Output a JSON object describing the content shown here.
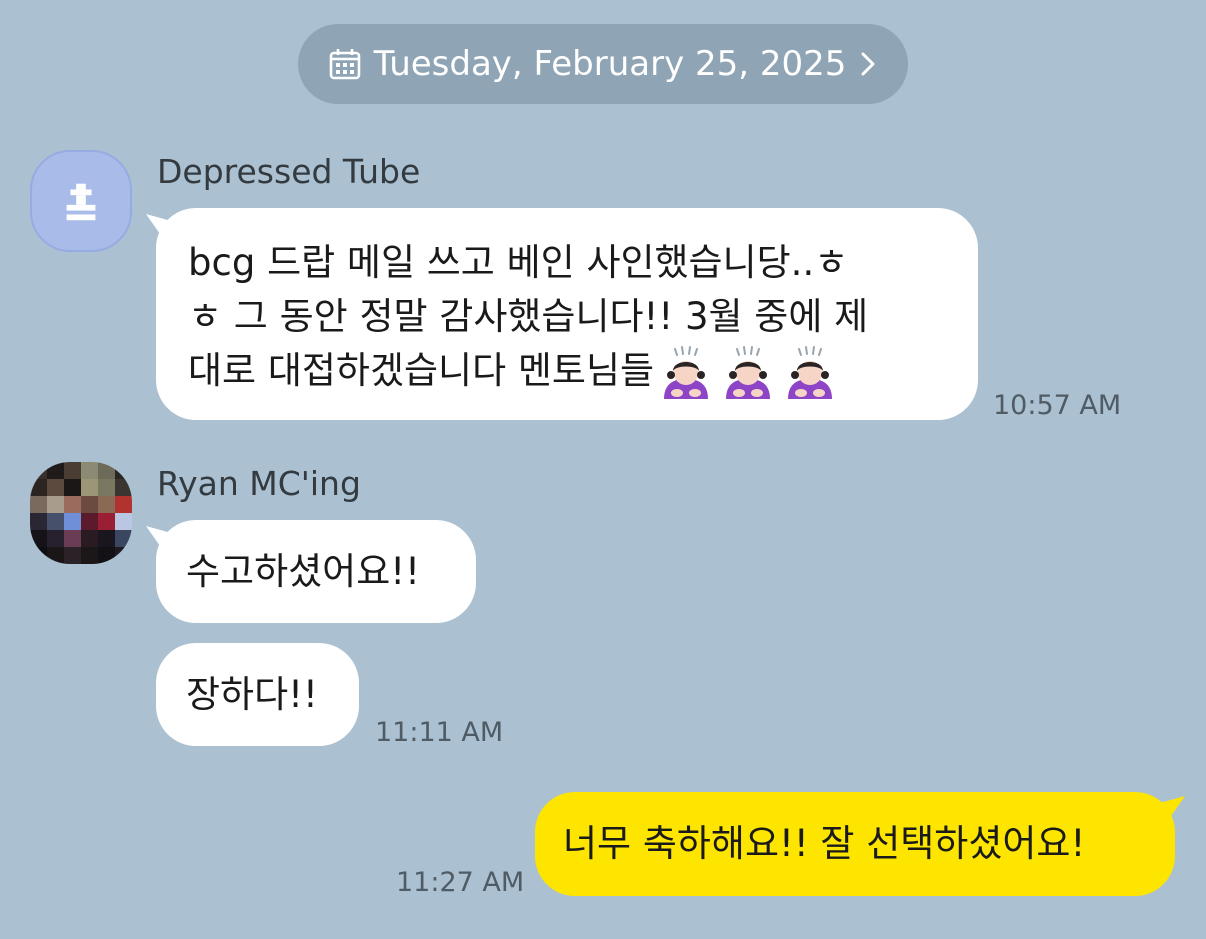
{
  "date_divider": {
    "label": "Tuesday, February 25, 2025",
    "icon": "calendar-icon",
    "chevron_icon": "chevron-right-icon"
  },
  "messages": [
    {
      "sender": "Depressed Tube",
      "avatar": "default-profile-icon",
      "bubbles": [
        {
          "lines": [
            "bcg 드랍 메일 쓰고 베인 사인했습니당..ㅎ",
            "ㅎ 그 동안 정말 감사했습니다!! 3월 중에 제",
            "대로 대접하겠습니다 멘토님들"
          ],
          "emojis": [
            "person-bowing-emoji",
            "person-bowing-emoji",
            "person-bowing-emoji"
          ]
        }
      ],
      "time": "10:57 AM"
    },
    {
      "sender": "Ryan MC'ing",
      "avatar": "pixelated-photo-avatar",
      "bubbles": [
        {
          "text": "수고하셨어요!!"
        },
        {
          "text": "장하다!!"
        }
      ],
      "time": "11:11 AM"
    },
    {
      "sender": "",
      "mine": true,
      "bubbles": [
        {
          "text": "너무 축하해요!! 잘 선택하셨어요!"
        }
      ],
      "time": "11:27 AM"
    }
  ],
  "colors": {
    "background": "#abc1d1",
    "date_pill": "#8fa4b4",
    "incoming_bubble": "#ffffff",
    "outgoing_bubble": "#fee500",
    "default_avatar": "#a9bbe9"
  }
}
